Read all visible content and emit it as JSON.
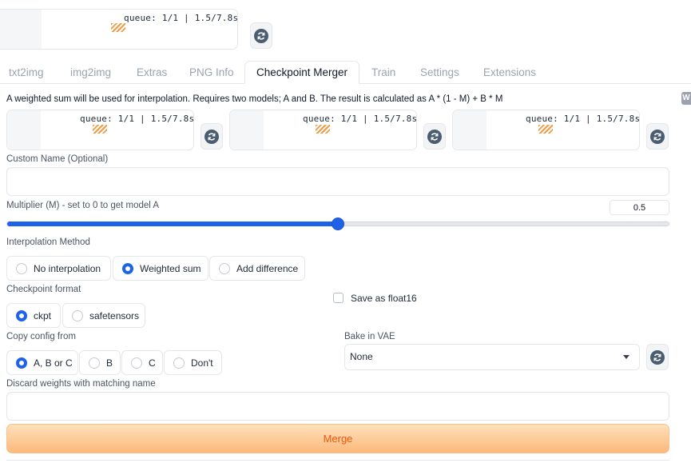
{
  "top_loader": {
    "queue": "queue: 1/1 | 1.5/7.8s"
  },
  "tabs": [
    {
      "label": "txt2img"
    },
    {
      "label": "img2img"
    },
    {
      "label": "Extras"
    },
    {
      "label": "PNG Info"
    },
    {
      "label": "Checkpoint Merger",
      "active": true
    },
    {
      "label": "Train"
    },
    {
      "label": "Settings"
    },
    {
      "label": "Extensions"
    }
  ],
  "description": "A weighted sum will be used for interpolation. Requires two models; A and B. The result is calculated as A * (1 - M) + B * M",
  "side_tab_letter": "W",
  "model_loaders": [
    {
      "queue": "queue: 1/1 | 1.5/7.8s"
    },
    {
      "queue": "queue: 1/1 | 1.5/7.8s"
    },
    {
      "queue": "queue: 1/1 | 1.5/7.8s"
    }
  ],
  "custom_name": {
    "label": "Custom Name (Optional)",
    "value": ""
  },
  "multiplier": {
    "label": "Multiplier (M) - set to 0 to get model A",
    "value": "0.5",
    "fraction": 0.5
  },
  "interpolation": {
    "label": "Interpolation Method",
    "options": [
      "No interpolation",
      "Weighted sum",
      "Add difference"
    ],
    "selected": "Weighted sum"
  },
  "checkpoint_format": {
    "label": "Checkpoint format",
    "options": [
      "ckpt",
      "safetensors"
    ],
    "selected": "ckpt"
  },
  "save_float16": {
    "label": "Save as float16",
    "checked": false
  },
  "copy_config": {
    "label": "Copy config from",
    "options": [
      "A, B or C",
      "B",
      "C",
      "Don't"
    ],
    "selected": "A, B or C"
  },
  "bake_vae": {
    "label": "Bake in VAE",
    "value": "None"
  },
  "discard_weights": {
    "label": "Discard weights with matching name",
    "value": ""
  },
  "merge_button": {
    "label": "Merge"
  },
  "colors": {
    "accent": "#1f62ea",
    "merge_text": "#ea580c",
    "merge_bg": "#fbb979",
    "spinner": "#f39a45"
  }
}
